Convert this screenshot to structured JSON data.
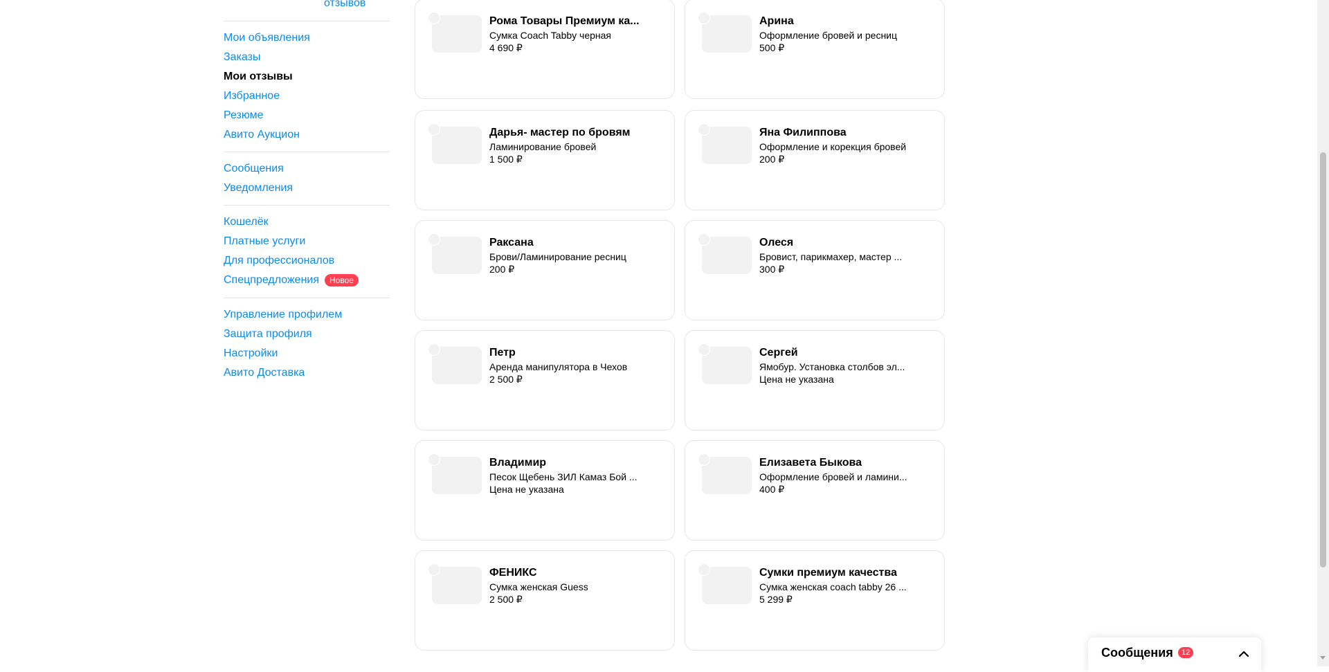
{
  "sidebar": {
    "top_link": "отзывов",
    "groups": [
      {
        "items": [
          {
            "label": "Мои объявления",
            "active": false
          },
          {
            "label": "Заказы",
            "active": false
          },
          {
            "label": "Мои отзывы",
            "active": true
          },
          {
            "label": "Избранное",
            "active": false
          },
          {
            "label": "Резюме",
            "active": false
          },
          {
            "label": "Авито Аукцион",
            "active": false
          }
        ]
      },
      {
        "items": [
          {
            "label": "Сообщения",
            "active": false
          },
          {
            "label": "Уведомления",
            "active": false
          }
        ]
      },
      {
        "items": [
          {
            "label": "Кошелёк",
            "active": false
          },
          {
            "label": "Платные услуги",
            "active": false
          },
          {
            "label": "Для профессионалов",
            "active": false
          },
          {
            "label": "Спецпредложения",
            "active": false,
            "badge": "Новое"
          }
        ]
      },
      {
        "items": [
          {
            "label": "Управление профилем",
            "active": false
          },
          {
            "label": "Защита профиля",
            "active": false
          },
          {
            "label": "Настройки",
            "active": false
          },
          {
            "label": "Авито Доставка",
            "active": false
          }
        ]
      }
    ]
  },
  "cards": [
    {
      "name": "Рома Товары Премиум ка...",
      "item": "Сумка Coach Tabby черная",
      "price": "4 690 ₽"
    },
    {
      "name": "Арина",
      "item": "Оформление бровей и ресниц",
      "price": "500 ₽"
    },
    {
      "name": "Дарья- мастер по бровям",
      "item": "Ламинирование бровей",
      "price": "1 500 ₽"
    },
    {
      "name": "Яна Филиппова",
      "item": "Оформление и корекция бровей",
      "price": "200 ₽"
    },
    {
      "name": "Раксана",
      "item": "Брови/Ламинирование ресниц",
      "price": "200 ₽"
    },
    {
      "name": "Олеся",
      "item": "Бровист, парикмахер, мастер ...",
      "price": "300 ₽"
    },
    {
      "name": "Петр",
      "item": "Аренда манипулятора в Чехов",
      "price": "2 500 ₽"
    },
    {
      "name": "Сергей",
      "item": "Ямобур. Установка столбов эл...",
      "price": "Цена не указана"
    },
    {
      "name": "Владимир",
      "item": "Песок Щебень ЗИЛ Камаз Бой ...",
      "price": "Цена не указана"
    },
    {
      "name": "Елизавета Быкова",
      "item": "Оформление бровей и ламини...",
      "price": "400 ₽"
    },
    {
      "name": "ФЕНИКС",
      "item": "Сумка женская Guess",
      "price": "2 500 ₽"
    },
    {
      "name": "Сумки премиум качества",
      "item": "Сумка женская coach tabby 26 ...",
      "price": "5 299 ₽"
    }
  ],
  "messages_widget": {
    "title": "Сообщения",
    "count": "12",
    "icon": "chevron-up-icon"
  },
  "colors": {
    "link": "#0a8bf0",
    "badge": "#ff4053",
    "thumb": "#f2f2f2"
  }
}
